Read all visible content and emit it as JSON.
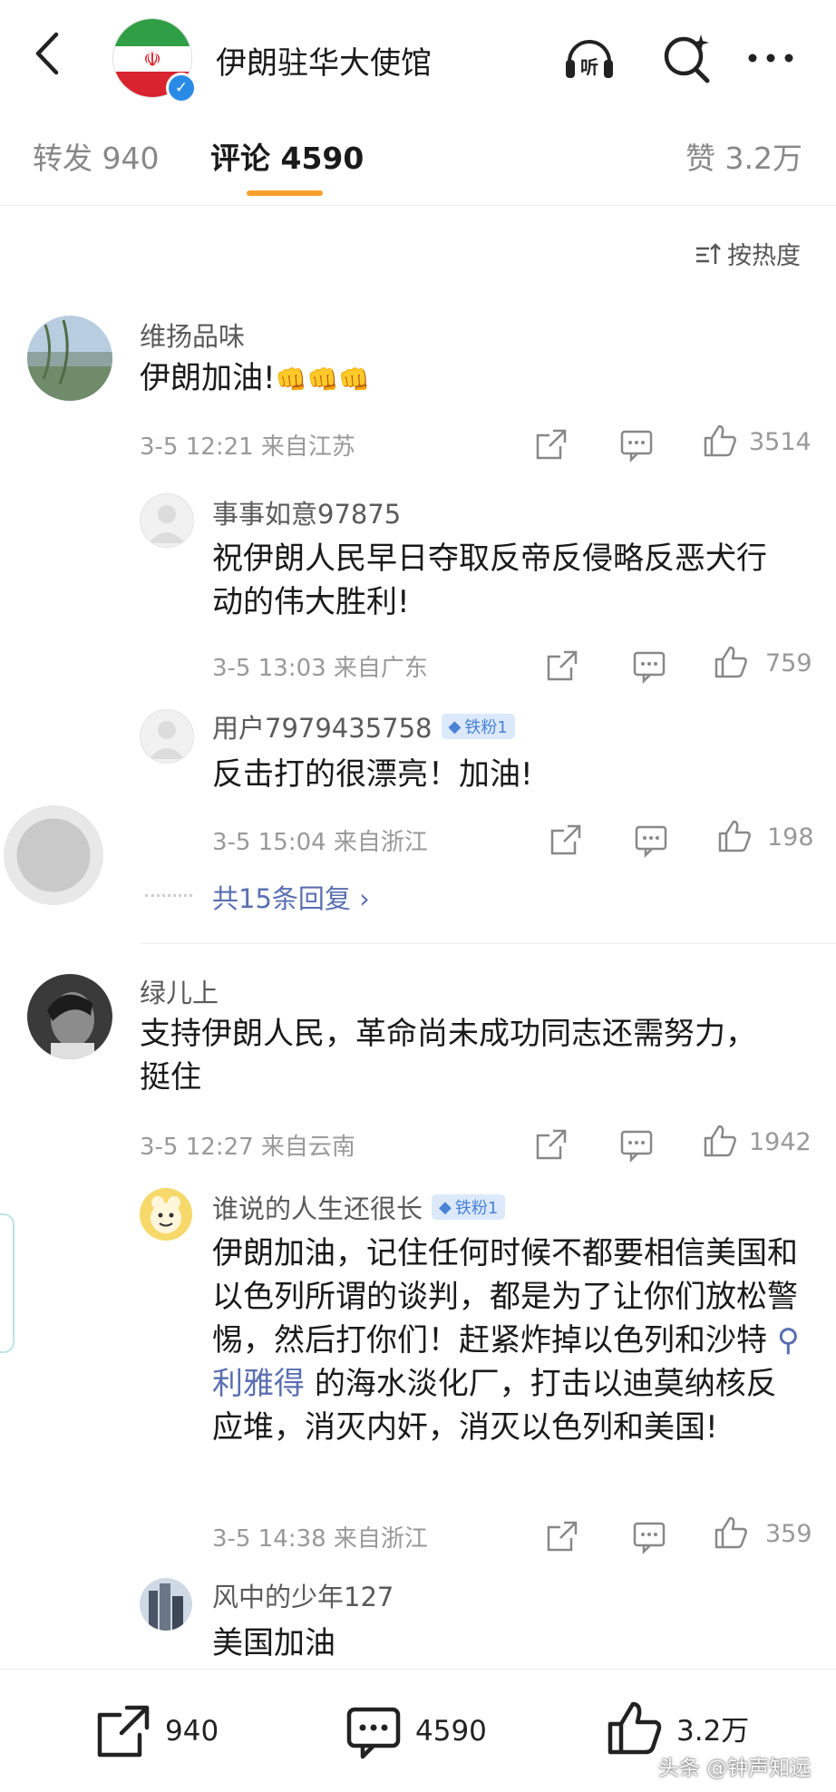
{
  "header": {
    "title": "伊朗驻华大使馆"
  },
  "tabs": [
    {
      "label": "转发 940"
    },
    {
      "label": "评论 4590"
    },
    {
      "label": "赞 3.2万"
    }
  ],
  "sort": {
    "label": "按热度"
  },
  "comments": [
    {
      "user": "维扬品味",
      "text": "伊朗加油!",
      "emoji": "👊👊👊",
      "meta": "3-5 12:21  来自江苏",
      "likes": "3514",
      "replies": [
        {
          "user": "事事如意97875",
          "text": "祝伊朗人民早日夺取反帝反侵略反恶犬行动的伟大胜利!",
          "meta": "3-5 13:03  来自广东",
          "likes": "759"
        },
        {
          "user": "用户7979435758",
          "badge": "铁粉1",
          "text": "反击打的很漂亮！加油!",
          "meta": "3-5 15:04  来自浙江",
          "likes": "198"
        }
      ],
      "more_replies": "共15条回复 ›"
    },
    {
      "user": "绿儿上",
      "text": "支持伊朗人民，革命尚未成功同志还需努力，挺住",
      "meta": "3-5 12:27  来自云南",
      "likes": "1942",
      "replies": [
        {
          "user": "谁说的人生还很长",
          "badge": "铁粉1",
          "text_before": "伊朗加油，记住任何时候不都要相信美国和以色列所谓的谈判，都是为了让你们放松警惕，然后打你们！赶紧炸掉以色列和沙特",
          "search_tag": "利雅得",
          "text_after": " 的海水淡化厂，打击以迪莫纳核反应堆，消灭内奸，消灭以色列和美国!",
          "meta": "3-5 14:38  来自浙江",
          "likes": "359"
        },
        {
          "user": "风中的少年127",
          "text": "美国加油"
        }
      ]
    }
  ],
  "bottom_bar": {
    "repost": "940",
    "comment": "4590",
    "like": "3.2万"
  },
  "watermark": "头条 @钟声知远",
  "colors": {
    "accent": "#f7a12b",
    "link": "#5a6fb1",
    "verified": "#2a8be6",
    "badge_bg": "#dbe9fb"
  }
}
